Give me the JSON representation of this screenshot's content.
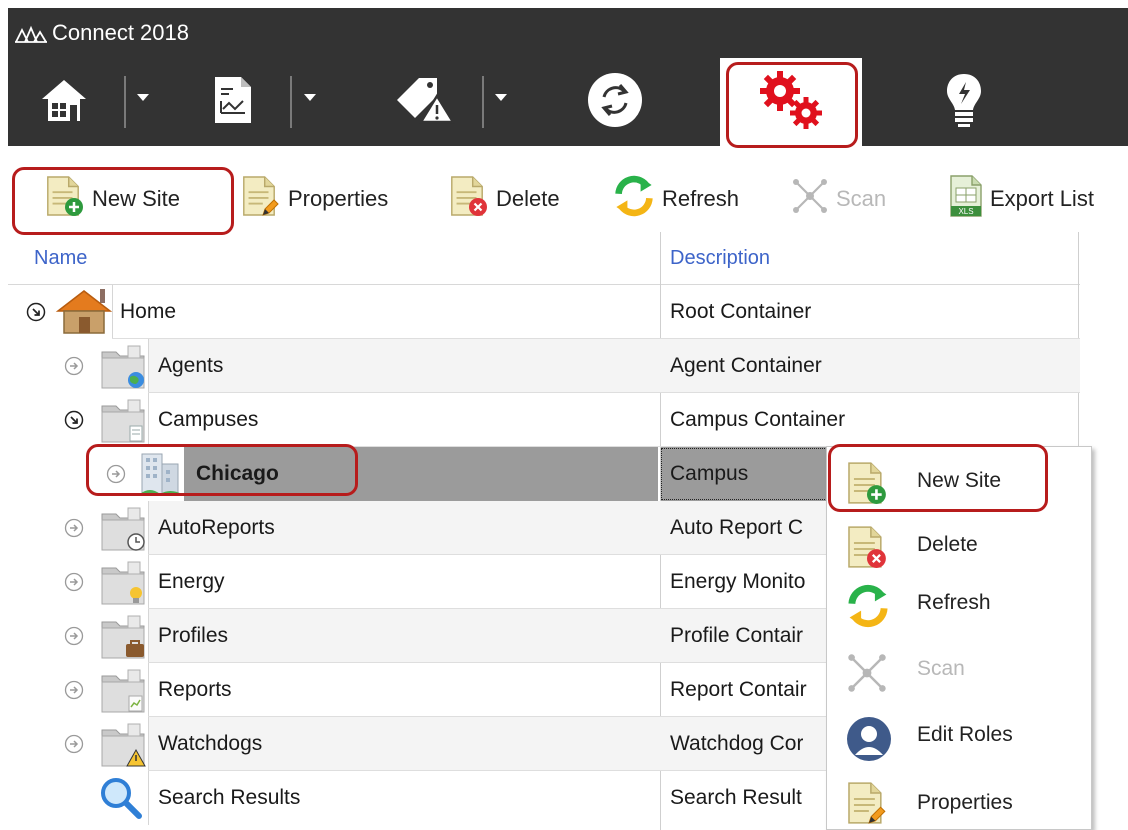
{
  "window": {
    "title": "Connect 2018"
  },
  "main_toolbar": {
    "buttons": [
      {
        "icon": "home-icon",
        "has_dropdown": true
      },
      {
        "icon": "report-chart-icon",
        "has_dropdown": true
      },
      {
        "icon": "alarm-tag-icon",
        "has_dropdown": true
      },
      {
        "icon": "sync-icon",
        "has_dropdown": false
      },
      {
        "icon": "settings-gears-icon",
        "active": true,
        "has_dropdown": false
      },
      {
        "icon": "lightbulb-icon",
        "has_dropdown": false
      }
    ]
  },
  "action_toolbar": {
    "new_site": "New Site",
    "properties": "Properties",
    "delete": "Delete",
    "refresh": "Refresh",
    "scan": "Scan",
    "export_list": "Export List"
  },
  "grid": {
    "headers": {
      "name": "Name",
      "description": "Description"
    },
    "rows": [
      {
        "name": "Home",
        "description": "Root Container",
        "icon": "house-icon",
        "expander": "expanded"
      },
      {
        "name": "Agents",
        "description": "Agent Container",
        "icon": "folder-globe-icon",
        "expander": "collapsed"
      },
      {
        "name": "Campuses",
        "description": "Campus Container",
        "icon": "folder-document-icon",
        "expander": "expanded"
      },
      {
        "name": "Chicago",
        "description": "Campus",
        "icon": "building-icon",
        "expander": "collapsed",
        "selected": true
      },
      {
        "name": "AutoReports",
        "description": "Auto Report C",
        "icon": "folder-clock-icon",
        "expander": "collapsed"
      },
      {
        "name": "Energy",
        "description": "Energy Monito",
        "icon": "folder-bulb-icon",
        "expander": "collapsed"
      },
      {
        "name": "Profiles",
        "description": "Profile Contair",
        "icon": "folder-briefcase-icon",
        "expander": "collapsed"
      },
      {
        "name": "Reports",
        "description": "Report Contair",
        "icon": "folder-report-icon",
        "expander": "collapsed"
      },
      {
        "name": "Watchdogs",
        "description": "Watchdog Cor",
        "icon": "folder-warning-icon",
        "expander": "collapsed"
      },
      {
        "name": "Search Results",
        "description": "Search Result",
        "icon": "magnifier-icon",
        "expander": "none"
      }
    ]
  },
  "context_menu": {
    "items": [
      {
        "label": "New Site",
        "icon": "new-site-icon",
        "enabled": true
      },
      {
        "label": "Delete",
        "icon": "delete-icon",
        "enabled": true
      },
      {
        "label": "Refresh",
        "icon": "refresh-icon",
        "enabled": true
      },
      {
        "label": "Scan",
        "icon": "scan-icon",
        "enabled": false
      },
      {
        "label": "Edit Roles",
        "icon": "user-roles-icon",
        "enabled": true
      },
      {
        "label": "Properties",
        "icon": "properties-icon",
        "enabled": true
      }
    ]
  },
  "colors": {
    "toolbar_bg": "#333333",
    "highlight": "#b71c1c",
    "header_text": "#3d64c9",
    "selection": "#9b9b9b",
    "gear_red": "#e0101d"
  }
}
